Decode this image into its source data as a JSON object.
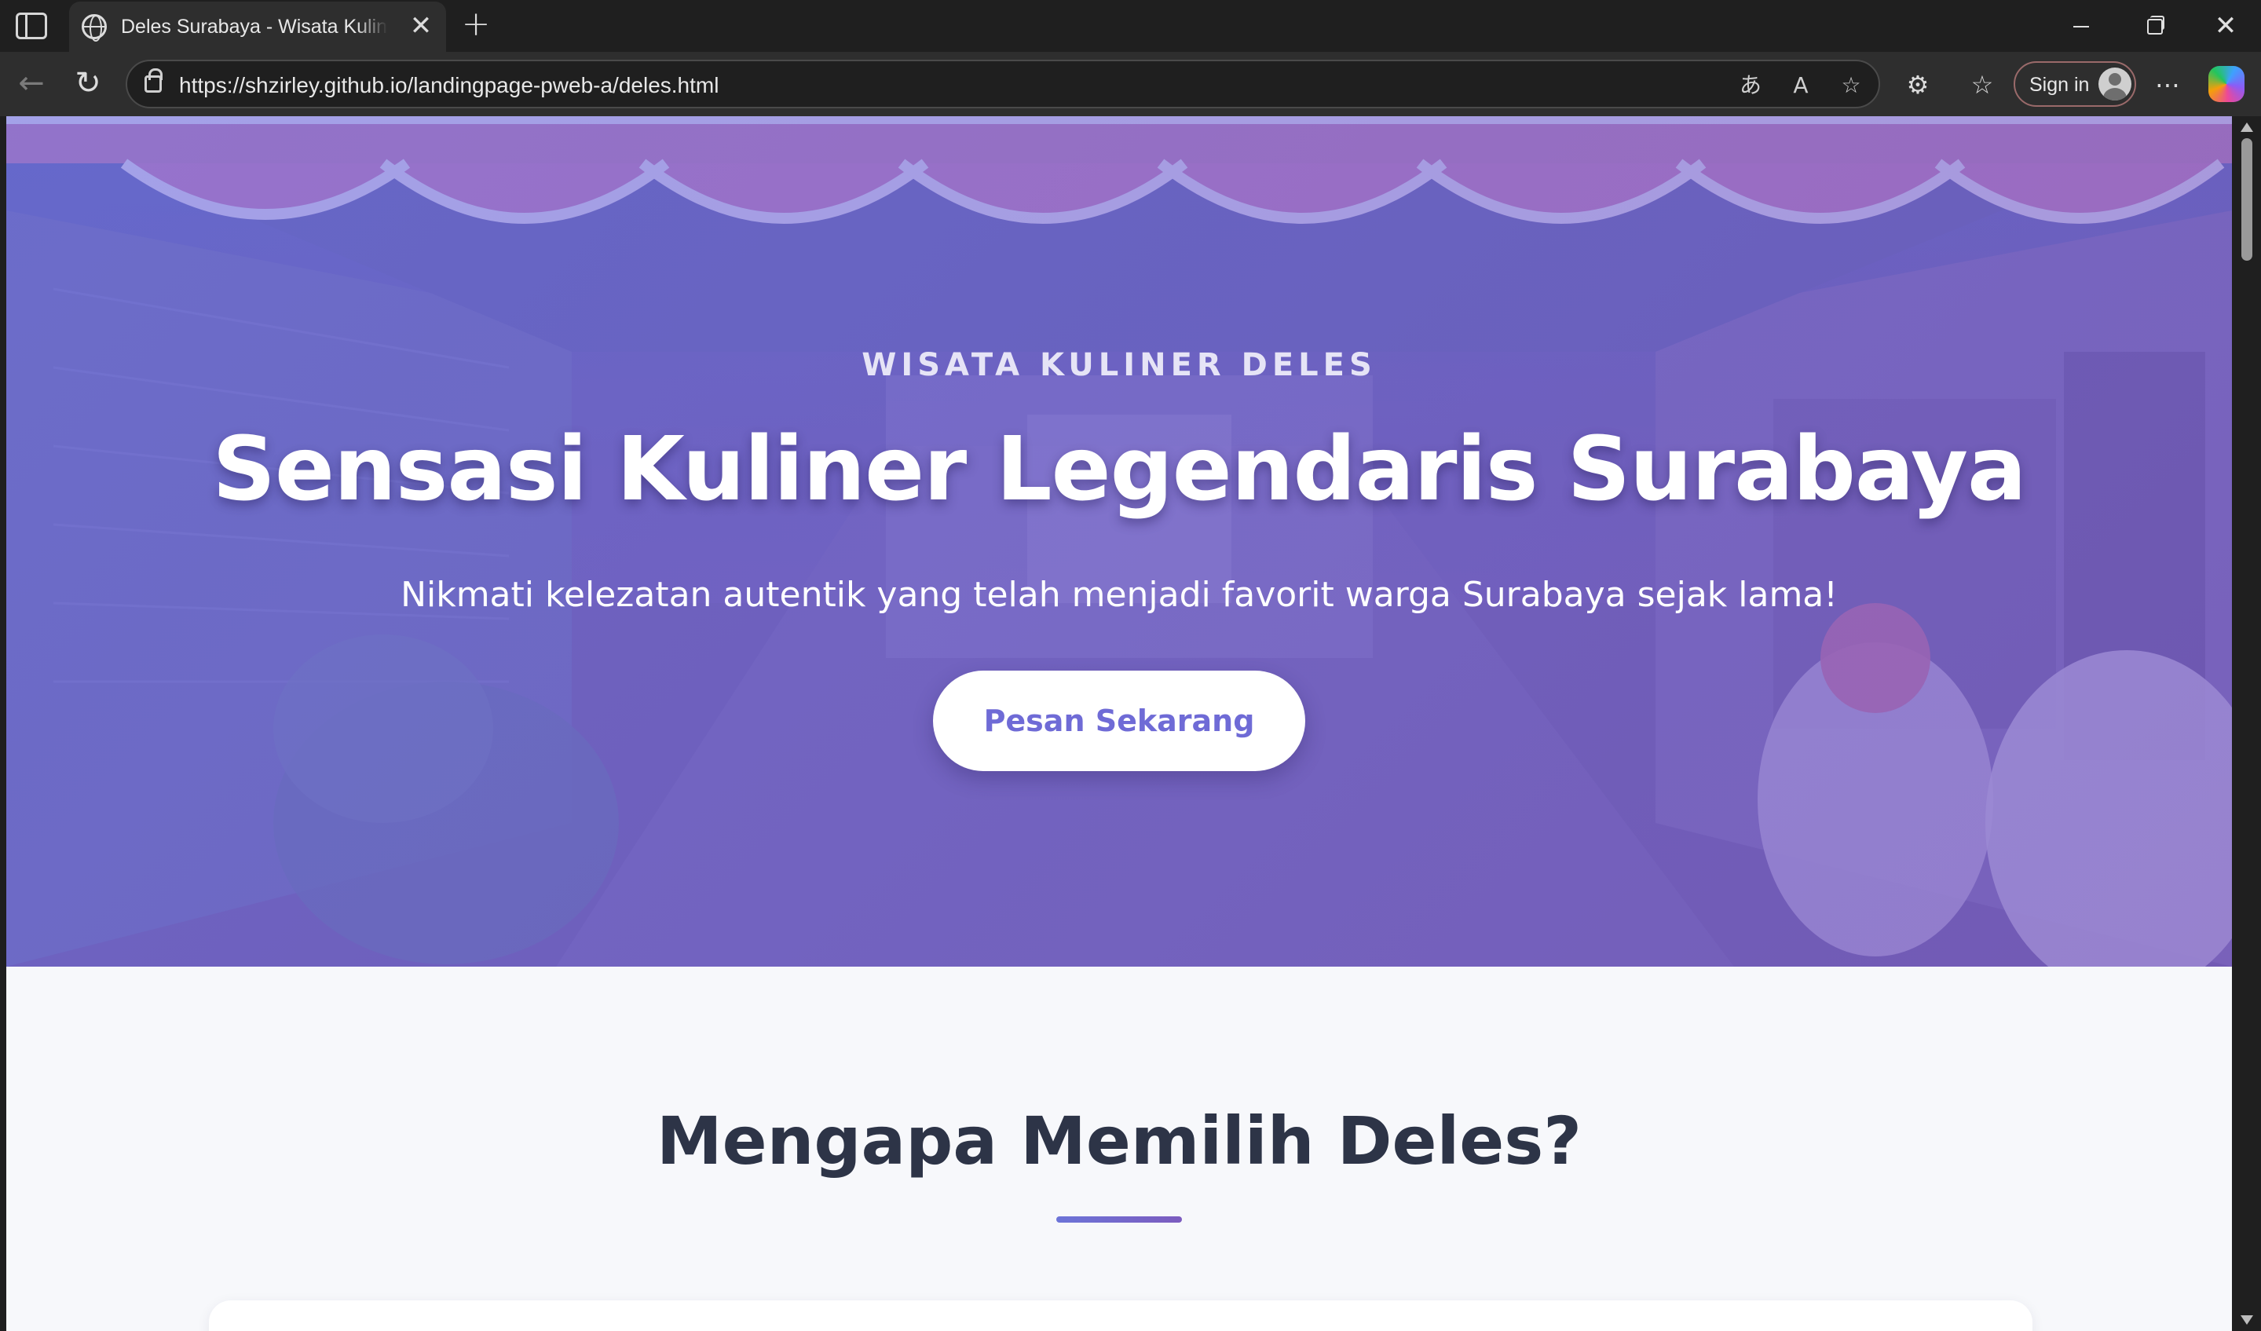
{
  "browser": {
    "tab": {
      "title": "Deles Surabaya - Wisata Kuliner Legendaris Surabaya"
    },
    "address_bar": {
      "url": "https://shzirley.github.io/landingpage-pweb-a/deles.html"
    },
    "signin_label": "Sign in",
    "icons": {
      "sidebar": "sidebar-icon",
      "globe": "globe-icon",
      "close": "close-icon",
      "new_tab": "plus-icon",
      "back": "back-arrow-icon",
      "reload": "reload-icon",
      "lock": "lock-icon",
      "translate": "translate-icon",
      "read_aloud": "read-aloud-icon",
      "favorite": "star-icon",
      "extensions": "puzzle-icon",
      "favorites": "favorites-list-icon",
      "more": "more-icon",
      "copilot": "copilot-icon"
    }
  },
  "hero": {
    "eyebrow": "WISATA KULINER DELES",
    "title": "Sensasi Kuliner Legendaris Surabaya",
    "subtitle": "Nikmati kelezatan autentik yang telah menjadi favorit warga Surabaya sejak lama!",
    "cta_label": "Pesan Sekarang"
  },
  "features": {
    "title": "Mengapa Memilih Deles?"
  },
  "colors": {
    "accent": "#6f6bd6",
    "hero_overlay_start": "#6c6edc",
    "hero_overlay_end": "#785abe",
    "heading": "#2d3447",
    "page_bg": "#f7f8fb"
  }
}
